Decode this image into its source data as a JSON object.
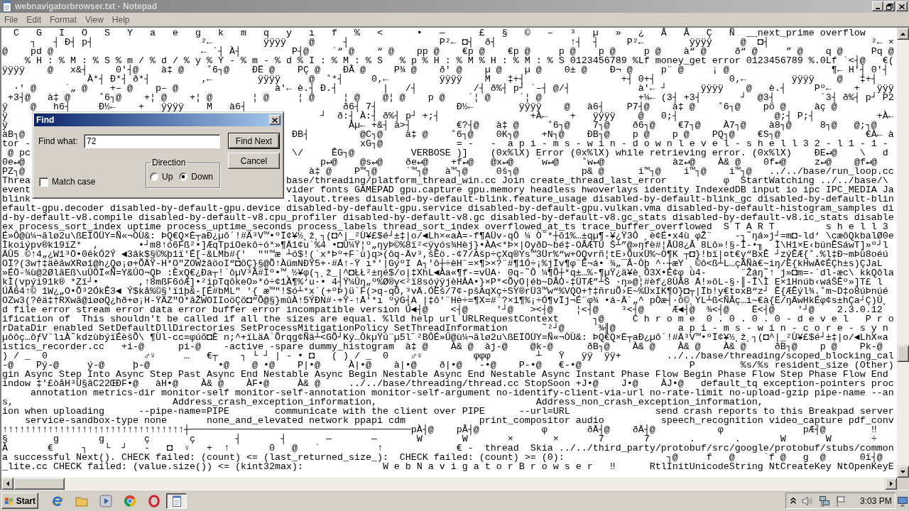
{
  "window": {
    "title": "webnavigatorbrowser.txt - Notepad",
    "active": false
  },
  "menu": [
    "File",
    "Edit",
    "Format",
    "View",
    "Help"
  ],
  "editor": {
    "lines": [
      {
        "text": "  C   G   I   O   S   Y   a   e   g   k   m   q   y   ı   f   %   <      •   —      £   §   ©   –   ³   µ   »   ¿   Â   Â   Ç   Ñ  __next_prime overflow"
      },
      {
        "text": "     ┐   ┤ Ð┤ p┤                   ²←         ÿÿÿÿ    @     ┤                P²← ◘┤  ð┤             ↑┤  ┤     P²←        ÿÿÿÿ     @  ◘┤                  ²← ×"
      },
      {
        "text": "@    pd @                          ← `┤ À┤         P┤@    `“ @    “ @    pp @    €p @    €p @     p @    p @     p @    à“ @     ð“ @     ” @    q @     Pq @"
      },
      {
        "text": "    % H : % M : % S % m / % d / % y % Y - % m - % d % I : % M : % S   % p % H : % M % H : % M : % S 0123456789 %Lf money_get error 0123456789 %.0Lf `<┤@   €("
      },
      {
        "text": "ÿÿÿÿ    @   x&┤     0'┤@    à‡ @    ˚6┐@    ÐË @    PÇ @    ÐÂ @     P¾ @    ð' @    µ @    µ @    0± @    Ð¬ @     p¨ @     ¡ @                  ¶← H'┤ 0'┤"
      },
      {
        "text": "               À*┤ Ð*┤ ð*┤         ‚←        ÿÿÿÿ     @  ˚*┤     0‚←         ÿÿÿÿ    M   ‡+┤                 +┤ 0+┤             0‚←        ÿÿÿÿ    @   ‡+┤"
      },
      {
        "text": "  ·' @     `„ @    +– @    p– @                 à'← è.┤ Ð.┤        |   /┤          /┤ ð%┤ p┘ `–┤ @/┤            à'← ┘      ÿÿÿÿ    @   è.┤     Pº←    +   ÿÿÿ"
      },
      {
        "text": " +3┤@   à‡ @     ˚6┐@    +¦ @    +¦ @       ¦ @     ¦ @     ¦ @    @¦ @    p @    `¦ @     `¦ @                 +¼← (3┤ +3┤       ┘  @3┤        `3┤ ð%┤ p┘ P2"
      },
      {
        "text": "ÿ    @   h6┤     Ð½←    +   ÿÿÿÿ    M   à6┤                 ð6┤ 7┤              Ð½←        ÿÿÿÿ    @   à6┤    P7┤@    à‡ @    ˚6┐@    pö @     àç @"
      },
      {
        "left": "ÿ",
        "right": "      ┘  ð:┤ À:┤ ð%┤ p┘ +;┤                +À←    +   ÿÿÿÿ    @   0;┤                 @;┤ P;┤           +À←"
      },
      {
        "left": "ÿ",
        "right": "           Àµ← +&┤ à>┤        €?┤@   à‡ @     ˚6┐@    7┐@    ð6┐@    €7┐@    À7┐@    à8┐@     8┐@   @;┐@"
      },
      {
        "left": "àB┐@",
        "right": " ÐB┤         @C┐@    à‡ @    ˚6┐@    0K┐@    +N┐@    ÐB┐@    p @    p @    PQ┐@    €S┐@               €À← à"
      },
      {
        "left": "tor -",
        "right": "             xG┐@             = -   -  a p i - m s - w i n - d o w n l e v e l - s h e l l 3 2 - l 1 - 1 -"
      },
      {
        "left": " @ pc",
        "right": " \\/     ÊG┐@          VERBOSE )]    (0x%lX) Error (0x%lX) while retrieving error. (0x%lX)    ÐE↵@    \\   d"
      },
      {
        "left": "0e↵@",
        "right": "      p↵@    @s↵@    ðe↵@    +f↵@   @x↵@    `w↵@    ˚w↵@            àz↵@    À& @    0f↵@     z↵@    @f↵@"
      },
      {
        "left": "PZ┐@",
        "right": "    à‡ @    P™┐@     `™┐@   à™┐@     0š┐@           p& @      i™┐@    i™┐@    i™┐@   ../../base/run_loop.cc"
      },
      {
        "left": "Threa",
        "right": "base/threading/platform_thread_win.cc Join create_thread_last_error          φ  StartWatching ../../base/\\"
      },
      {
        "left": "event",
        "right": "vider fonts GAMEPAD gpu.capture gpu.memory headless hwoverlays identity IndexedDB input io ipc IPC_MEDIA Ja"
      },
      {
        "left": "blink",
        "right": ".layout.trees disabled-by-default-blink.feature_usage disabled-by-default-blink_gc disabled-by-default-blin"
      },
      {
        "text": "efault-gpu.decoder disabled-by-default-gpu.device disabled-by-default-gpu.service disabled-by-default-gpu.vulkan.vma disabled-by-default-histogram_samples di"
      },
      {
        "text": "d-by-default-v8.compile disabled-by-default-v8.cpu_profiler disabled-by-default-v8.gc disabled-by-default-v8.gc_stats disabled-by-default-v8.ic_stats disable"
      },
      {
        "text": "ex process_sort_index uptime process_uptime_seconds process_labels thread_sort_index overflowed_at_ts trace_buffer_overflowed  S T A R T         s h e l l 3"
      },
      {
        "text": "É»Ô@ù¼¬ãlø2u\\ßEÏÖÜY=Ñ«¬ÒÙ&: ÞQ€Q×Ė┬aÐ¿µô´!#Ä³V™•ºÏ¢¥½¸ž¸┐(◘^|_²Ù¥£$é┘±‡|o/◄Lh×«aÀ=-f¶AÜv-qÔ ¼ Ò˜*┼õ1%…±qµ¶-¥¿Ÿ3Ô ¸è¢É•x4ù φŽ¨    -┐˜ŋá»j┘=m◘-ld‘ \\cæôQkbalØ0e"
      },
      {
        "text": "Ìkoiýpv®k19ïZ*  ,       •┘m8↑ó6Fß²•]ÆqTpiOekô÷ó*»¶Å1¢u`%4 •◘Û¼Ÿ¦º„ŋyÞ©%8ï²<ÿyós¾Hèj}•ÀA<*Þ×|OyðD~bé‡-OÂÆTÛ Š┴”@»ŋfè#¦ÂÜ8¿Â 8Lô»!§-Î-•╖  Ì\\H1×E‹búnÊSáwT]»º┘l"
      },
      {
        "text": "ÄÛ5 ©↑4„¿W1³Ö•0êkÓ2Ý ◄3âk$§©%þ1ï'É[-&LMb#{'  \"\"™æ ┴ó$!(`x*Þº+F`ù)q>(ôq-Äv³,šÉö.-¢7/Ašp÷çXq®Ys™3Ür%“w+OQvrñ¦tE›ÕuxÜ%~O¶K ┬◘}!bï|¤t€y“BxÊ ┘zýÊÆ{˚.%l‡Ð~mÞü8oéú"
      },
      {
        "text": "OÏ?(3w†‡äêãwXRøî@h¿Qø¡ø+ÕÄŸ-H*O\"ZOWžâöoI“◘õÇ}§@Õ↑ÀümNÐŸ5+·#Å↑-Ÿ ı*'|GýºI A┐'ô┼÷èH¨=×¶>×?¨#¶1Ó÷¡%jÏv¶φ¨Ê¬á• ¾„¯Â-Òþ ^·┼æY ¸©ô<ß┴L…çÂÑà€~iŋ/Ë{kHwÄ¢ÉÇh±s)ÇJaL"
      },
      {
        "text": "»ÉÖ-¾ù@2ØlãEß\\uÛÖÏ«Ñ=Y&ÛO¬QÞ :ÈxQ€¿Ða┬!´ôµV³Ä#Ïº•™¸½¥φ(┐¸ž_|^◘ŁŁ²±ŋé$/o|‡XhL◄Àa«¶f-=vÜA· 0q-˜Ô ¼¶Õ┼*q±…%-¶µŸ¿ä¥è¸Ô3X•É¢φ ù4-      ¨Žáŋ˜↑ j»◘m=-´dl-æc\\ kkQôla"
      },
      {
        "text": "kÌ(vpýi91k® *Zï┘•       ,↑8mßF6óÆ]•²ipTqôkeO»*ó÷¢1Å¶%‘u·• 4┤Ÿ¼Ûŋ„º%Ø®y<²ï8sóýÿjèHÀA•}×P*<ÕyO|éb~DÂO-‡ÜTÆ”┴Š ·ŋ»@¦#èf¿8ÙÂ8 Å!»ôL-§·║-Î\\Ì E×1Hnúb‹wáŠÊº»]T£ l"
      },
      {
        "text": "ÚÂ64↑© 1W¿„O•Õ³2ÓkÊ3◄ Ý$kå%©§'ï1þ&-[É#bML\" '{ æ™\"!$ó┴*x´(+ºÞ)ü`F(>q-qÔ,³vÄ.ÓËš/7¢-pšAqXç÷SY®rÜ3™w“%VQO+†‡ñruÕ›E~%ÜxIK¶O}◘┬|Ïb!y€t¤xB“z┘ Ê{ÆÊýl¾.˚m~D‡o8úÞnúé"
      },
      {
        "text": "OZw3(?êä‡†RXwã@iøøQ¿hð+ø¡H-ŸÄZ\"O*âŽWOIIoöÇõ◘“Õ@§}mûÀ↑5ÝÐN#·+Ÿ-↑Å'*ı ºýG┤A |‡ô'¨Hè÷=¶X=#¨?×1¶%¡÷Ó¶vÏj¬É¨φ¾ •á-Ä`„^ pÒæ┤·ô©¸YL┴ß<ÑÂç…i~€à{Ë/ŋÄwHkÉφ¢s±hÇa┘Ç)Û¸"
      },
      {
        "text": "d file error stream error data error buffer error incompatible version Ú◄┤@    <┤@     '┘@   ><┤@    ¦<┤@    ³<┤@     Æ◄┤@  ¾<┤@    Ë<┤@    '┘@    2.3.0.12"
      },
      {
        "text": "ification of  This shouldn't be called if all the sizes are equal. %lld help url URLRequestContext      ┐@     C h r o m e  0 . 0 . 0 . 0 - d e v e l   P r o"
      },
      {
        "text": "rDataDir enabled SetDefaultDllDirectories SetProcessMitigationPolicy SetThreadInformation      ˜²┘@     `¾╢@           a p i - m s - w i n - c o r e - s y n"
      },
      {
        "text": "µôôç…ôƒV¨lıÀ˜kdzùbýïÉèšÕ\\ ¶Ùl-cc=φúõ◘È n;^+ïLäA`Õrqg¢Ñä┴<GÕ┘Ký…ÔkµŸú¨µ5l˝²BÔÉ»Û@ù¼¬ãlø2u\\ßEÏÖÜY=Ñ«¬ÒÙ&: ÞQ€Q×Ė┬aÐ¿µô´!#Ä³V™•ºÏ¢¥½¸ž¸┐(◘^|_²Ù¥£$é┘±‡|o/◄LhX«a"
      },
      {
        "text": "istics_recorder.cc   +i-@      pi-@    -active -spare dummy_histogram  à‡ @    À& @  àj-@    @k-@      ðB┐@    À& @    À& @    À& @     ðB┐@    p @    Pk-@"
      },
      {
        "text": ") / _  0                 ♂♀     …   €┬    ┐ └ ┘ | - • ◘   ( ) / _  0    ♂♀         φφφ        ┴   Ÿ   ÿÿ  ÿÿ+        ../../base/threading/scoped_blocking_cal"
      },
      {
        "text": "-@    Pý-@     ý-@     þ-@            •@    @ •@    P|•@     À|•@    à|•@    ð|•@   -•@    P-•@   €-•@                   P        %s/%s resident_size (Other)"
      },
      {
        "text": "gin Async Step Into Async Step Past Async End Nestable Async Begin Nestable Async End Nestable Async Instant Phase Flow Begin Phase Flow Step Phase Flow End"
      },
      {
        "text": "indow ‡'£òåH³Ù§âC22ŒÐF•@   àH•@    À& @    ÀF•@     À& @     ../../base/threading/thread.cc StopSoon +J•@    J•@    ÀJ•@   default_tq exception-pointers proc"
      },
      {
        "text": "     annotation metrics-dir monitor-self monitor-self-annotation monitor-self-argument no-identify-client-via-url no-rate-limit no-upload-gzip pipe-name --an"
      },
      {
        "text": "s,                            Address_crash_exception_information,                            Address_non_crash_exception_information,"
      },
      {
        "text": "ion when uploading      --pipe-name=PIPE        communicate with the client over PIPE      --url=URL               send crash reports to this Breakpad server"
      },
      {
        "text": "    service-sandbox-type none       none_and_elevated network ppapi cdm             print_compositor audio          speech_recognition video_capture pdf_conv"
      },
      {
        "text": "↑↑↑↑↑↑↑↑↑↑↑↑↑↑↑↑↑↑↑↑↑↑↑↑↑↑↑↑↑↑↑↑┼───────────────────────────────────────pÀ┤@    pÂ┤@           φ       ðÄ┤@    ðÄ┤@           φ              pÆ┤@        ‼"
      },
      {
        "text": "§        g       g       ç       ç       ┤       ┤       —       —       W       W       ×       ×       7       7       .       .       W       W       ÷"
      },
      {
        "text": "À       €     ┐   └  ┘   -   ◘  ♀   +  ↑       0   @   `          ↑             € -  thread  Skia ../../third_party/protobuf/src/google/protobuf/stubs/common"
      },
      {
        "text": "a successful Next(). CHECK failed: (count) <= (last_returned_size_):  CHECK failed: (count) >= (0):                  ┐@     f   @     `f @   g  @      0ï┤@"
      },
      {
        "text": "_lite.cc CHECK failed: (value.size()) <= (kint32max):              W e b N a v i g a t o r B r o w s e r   ‼      RtlInitUnicodeString NtCreateKey NtOpenKeyE"
      }
    ]
  },
  "find_dialog": {
    "title": "Find",
    "active": true,
    "find_what": {
      "label": "Find what:",
      "value": "72"
    },
    "match_case": {
      "label": "Match case",
      "checked": false
    },
    "direction": {
      "label": "Direction",
      "options": [
        {
          "label": "Up",
          "selected": false
        },
        {
          "label": "Down",
          "selected": true
        }
      ]
    },
    "buttons": [
      {
        "label": "Find Next",
        "default": true
      },
      {
        "label": "Cancel",
        "default": false
      }
    ]
  },
  "taskbar": {
    "start": "Start",
    "tasks": [
      {
        "selected": true
      }
    ],
    "clock": "3:03 PM"
  }
}
